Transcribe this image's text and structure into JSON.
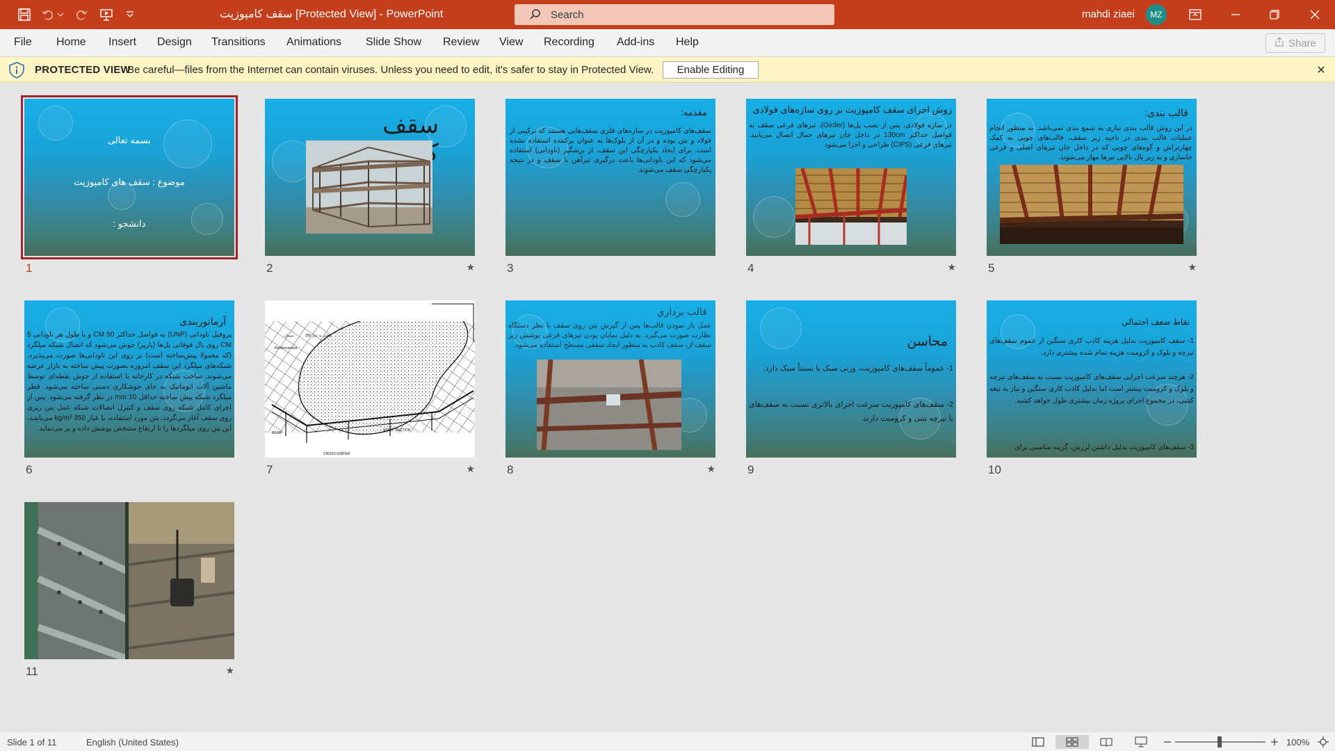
{
  "titlebar": {
    "title": "سقف کامپوزیت [Protected View] - PowerPoint",
    "search_placeholder": "Search",
    "user_name": "mahdi ziaei",
    "user_initials": "MZ"
  },
  "ribbon": {
    "tabs": [
      "File",
      "Home",
      "Insert",
      "Design",
      "Transitions",
      "Animations",
      "Slide Show",
      "Review",
      "View",
      "Recording",
      "Add-ins",
      "Help"
    ],
    "share_label": "Share"
  },
  "protected_view": {
    "title": "PROTECTED VIEW",
    "message": "Be careful—files from the Internet can contain viruses. Unless you need to edit, it's safer to stay in Protected View.",
    "enable_button": "Enable Editing"
  },
  "slides": [
    {
      "number": "1",
      "selected": true,
      "has_transition": false,
      "lines": [
        "بسمه تعالی",
        "موضوع : سقف های کامپوزیت",
        "دانشجو :"
      ]
    },
    {
      "number": "2",
      "has_transition": true,
      "title": "سقف کامپوزیت"
    },
    {
      "number": "3",
      "has_transition": false,
      "title": "مقدمه:",
      "body": "سقف‌های کامپوزیت در سازه‌های فلزی سقف‌هایی هستند که ترکیبی از فولاد و بتن بوده و در آن از بلوک‌ها به عنوان پرکننده استفاده نشده است. برای ایجاد یکپارچگی این سقف، از برشگیر (ناودانی) استفاده می‌شود که این ناودانی‌ها باعث درگیری تیرآهن با سقف و در نتیجه یکپارچگی سقف می‌شوند."
    },
    {
      "number": "4",
      "has_transition": true,
      "title": "روش اجرای سقف کامپوزیت بر روی سازه‌های فولادی",
      "body": "در سازه فولادی، پس از نصب پل‌ها (Girder)، تیرهای فرعی سقف به فواصل حداکثر 130cm در داخل جان تیرهای حمال اتصال می‌یابند. تیرهای فرعی (CIPS) طراحی و اجرا می‌شود."
    },
    {
      "number": "5",
      "has_transition": true,
      "title": "قالب بندی:",
      "body": "در این روش قالب بندی نیازی به شمع بندی نمی‌باشد. به منظور انجام عملیات قالب بندی در ناحیه زیر سقف، قالب‌های چوبی به کمک چهارتراش و گوه‌های چوبی که در داخل جان تیرهای اصلی و فرعی جاسازی و به زیر بال بالایی تیرها مهار می‌شوند."
    },
    {
      "number": "6",
      "has_transition": false,
      "title": "آرماتوربندی",
      "body": "پروفیل ناودانی (UNP) به فواصل حداکثر 50 CM و با طول هر ناودانی 5 CM روی بال فوقانی پل‌ها (بارپر) جوش می‌شود که اتصال شبکه میلگرد (که معمولا پیش‌ساخته است) بر روی این ناودانی‌ها صورت می‌پذیرد. شبکه‌های میلگرد این سقف امروزه بصورت پیش ساخته به بازار عرضه می‌شوند. ساخت شبکه در کارخانه با استفاده از جوش نقطه‌ای توسط ماشین آلات اتوماتیک به جای جوشکاری دستی ساخته می‌شود. قطر میلگرد شبکه پیش ساخته حداقل 10 mm در نظر گرفته می‌شود. پس از اجرای کامل شبکه روی سقف و کنترل اتصالات شبکه عمل بتن ریزی روی سقف آغاز می‌گردد. بتن مورد استفاده، با عیار 350 kg/m³ می‌باشد، این بتن روی میلگردها را تا ارتفاع مشخص پوشش داده و پر می‌نماید."
    },
    {
      "number": "7",
      "has_transition": true,
      "drawing_labels": [
        "بتن به عیار 350kg",
        "سیمان",
        "Reinforcement",
        "BEAM",
        "CROSS GIRDER",
        "STEEL SECTION"
      ]
    },
    {
      "number": "8",
      "has_transition": true,
      "title": "قالب برداري",
      "body": "عمل باز نمودن قالب‌ها پس از گیرش بتن روی سقف با نظر دستگاه نظارت صورت می‌گیرد. به دلیل نمایان بودن تیرهای فرعی پوشش زیر سقف از، سقف کاذب به منظور ایجاد سقفی مسطح استفاده می‌شود."
    },
    {
      "number": "9",
      "has_transition": false,
      "title": "محاسن",
      "body": [
        "1- عموماً سقف‌های کامپوزیت، وزنی سبک یا نسبتاً سبک دارد.",
        "2- سقف‌های کامپوزیت سرعت اجرای بالاتری نسبت به سقف‌های با تیرچه بتنی و کرومیت دارند."
      ]
    },
    {
      "number": "10",
      "has_transition": false,
      "title": "نقاط ضعف احتمالی",
      "body": [
        "1- سقف کامپوزیت بدلیل هزینه کاذب کاری سنگین از عموم سقف‌های تیرچه و بلوک و کرومیت هزینه تمام شده بیشتری دارد.",
        "2- هرچند سرعت اجرایی سقف‌های کامپوزیت نسبت به سقف‌های تیرچه و بلوک و کرومیت بیشتر است اما بدلیل کاذب کاری سنگین و نیاز به تیغه کشی، در مجموع اجرای پروژه زمان بیشتری طول خواهد کشید.",
        "3- سقف‌های کامپوزیت بدلیل داشتن لرزش، گزینه مناسبی برای"
      ]
    },
    {
      "number": "11",
      "has_transition": true
    }
  ],
  "statusbar": {
    "slide_info": "Slide 1 of 11",
    "language": "English (United States)",
    "zoom": "100%",
    "zoom_level": 0.5
  }
}
